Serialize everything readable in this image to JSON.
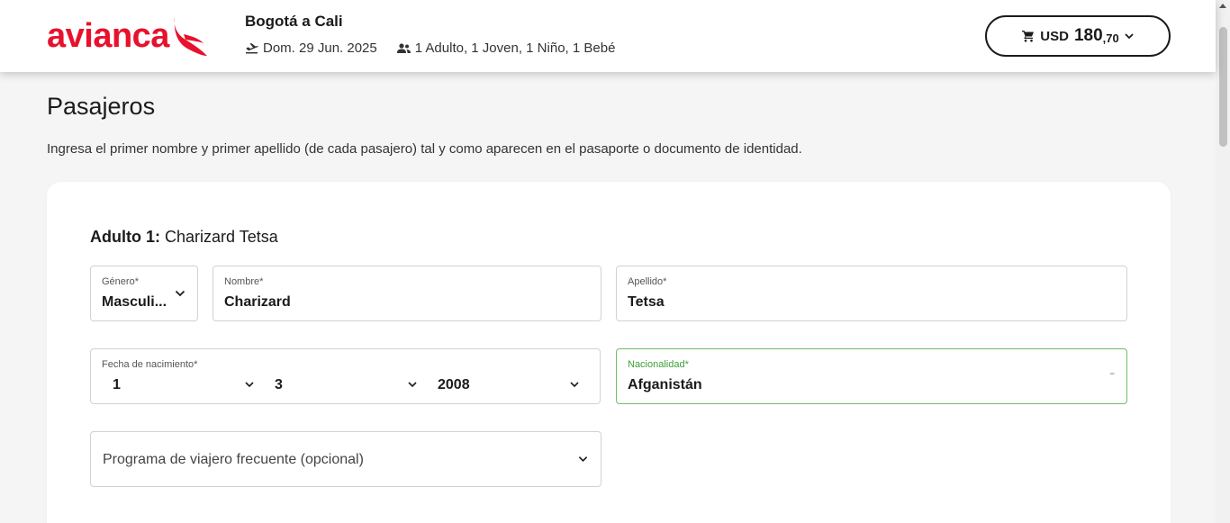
{
  "header": {
    "logo_text": "avianca",
    "route": "Bogotá a Cali",
    "date": "Dom. 29 Jun. 2025",
    "passengers": "1 Adulto, 1 Joven, 1 Niño, 1 Bebé",
    "cart": {
      "currency": "USD",
      "amount": "180",
      "decimals": ",70"
    }
  },
  "icons": {
    "takeoff": "plane-takeoff-icon",
    "passengers": "people-icon",
    "cart": "shopping-cart-icon",
    "chevron": "chevron-down-icon"
  },
  "colors": {
    "brand_red": "#e8112d",
    "active_green": "#3e9f3a",
    "text_dark": "#1b1b1b"
  },
  "page": {
    "title": "Pasajeros",
    "description": "Ingresa el primer nombre y primer apellido (de cada pasajero) tal y como aparecen en el pasaporte o documento de identidad."
  },
  "passenger": {
    "heading_label": "Adulto 1:",
    "heading_name": "Charizard Tetsa",
    "gender": {
      "label": "Género*",
      "value": "Masculi..."
    },
    "first_name": {
      "label": "Nombre*",
      "value": "Charizard"
    },
    "last_name": {
      "label": "Apellido*",
      "value": "Tetsa"
    },
    "birthdate": {
      "label": "Fecha de nacimiento*",
      "day": "1",
      "month": "3",
      "year": "2008"
    },
    "nationality": {
      "label": "Nacionalidad*",
      "value": "Afganistán",
      "clear": "--"
    },
    "frequent_flyer": {
      "placeholder": "Programa de viajero frecuente (opcional)"
    }
  }
}
